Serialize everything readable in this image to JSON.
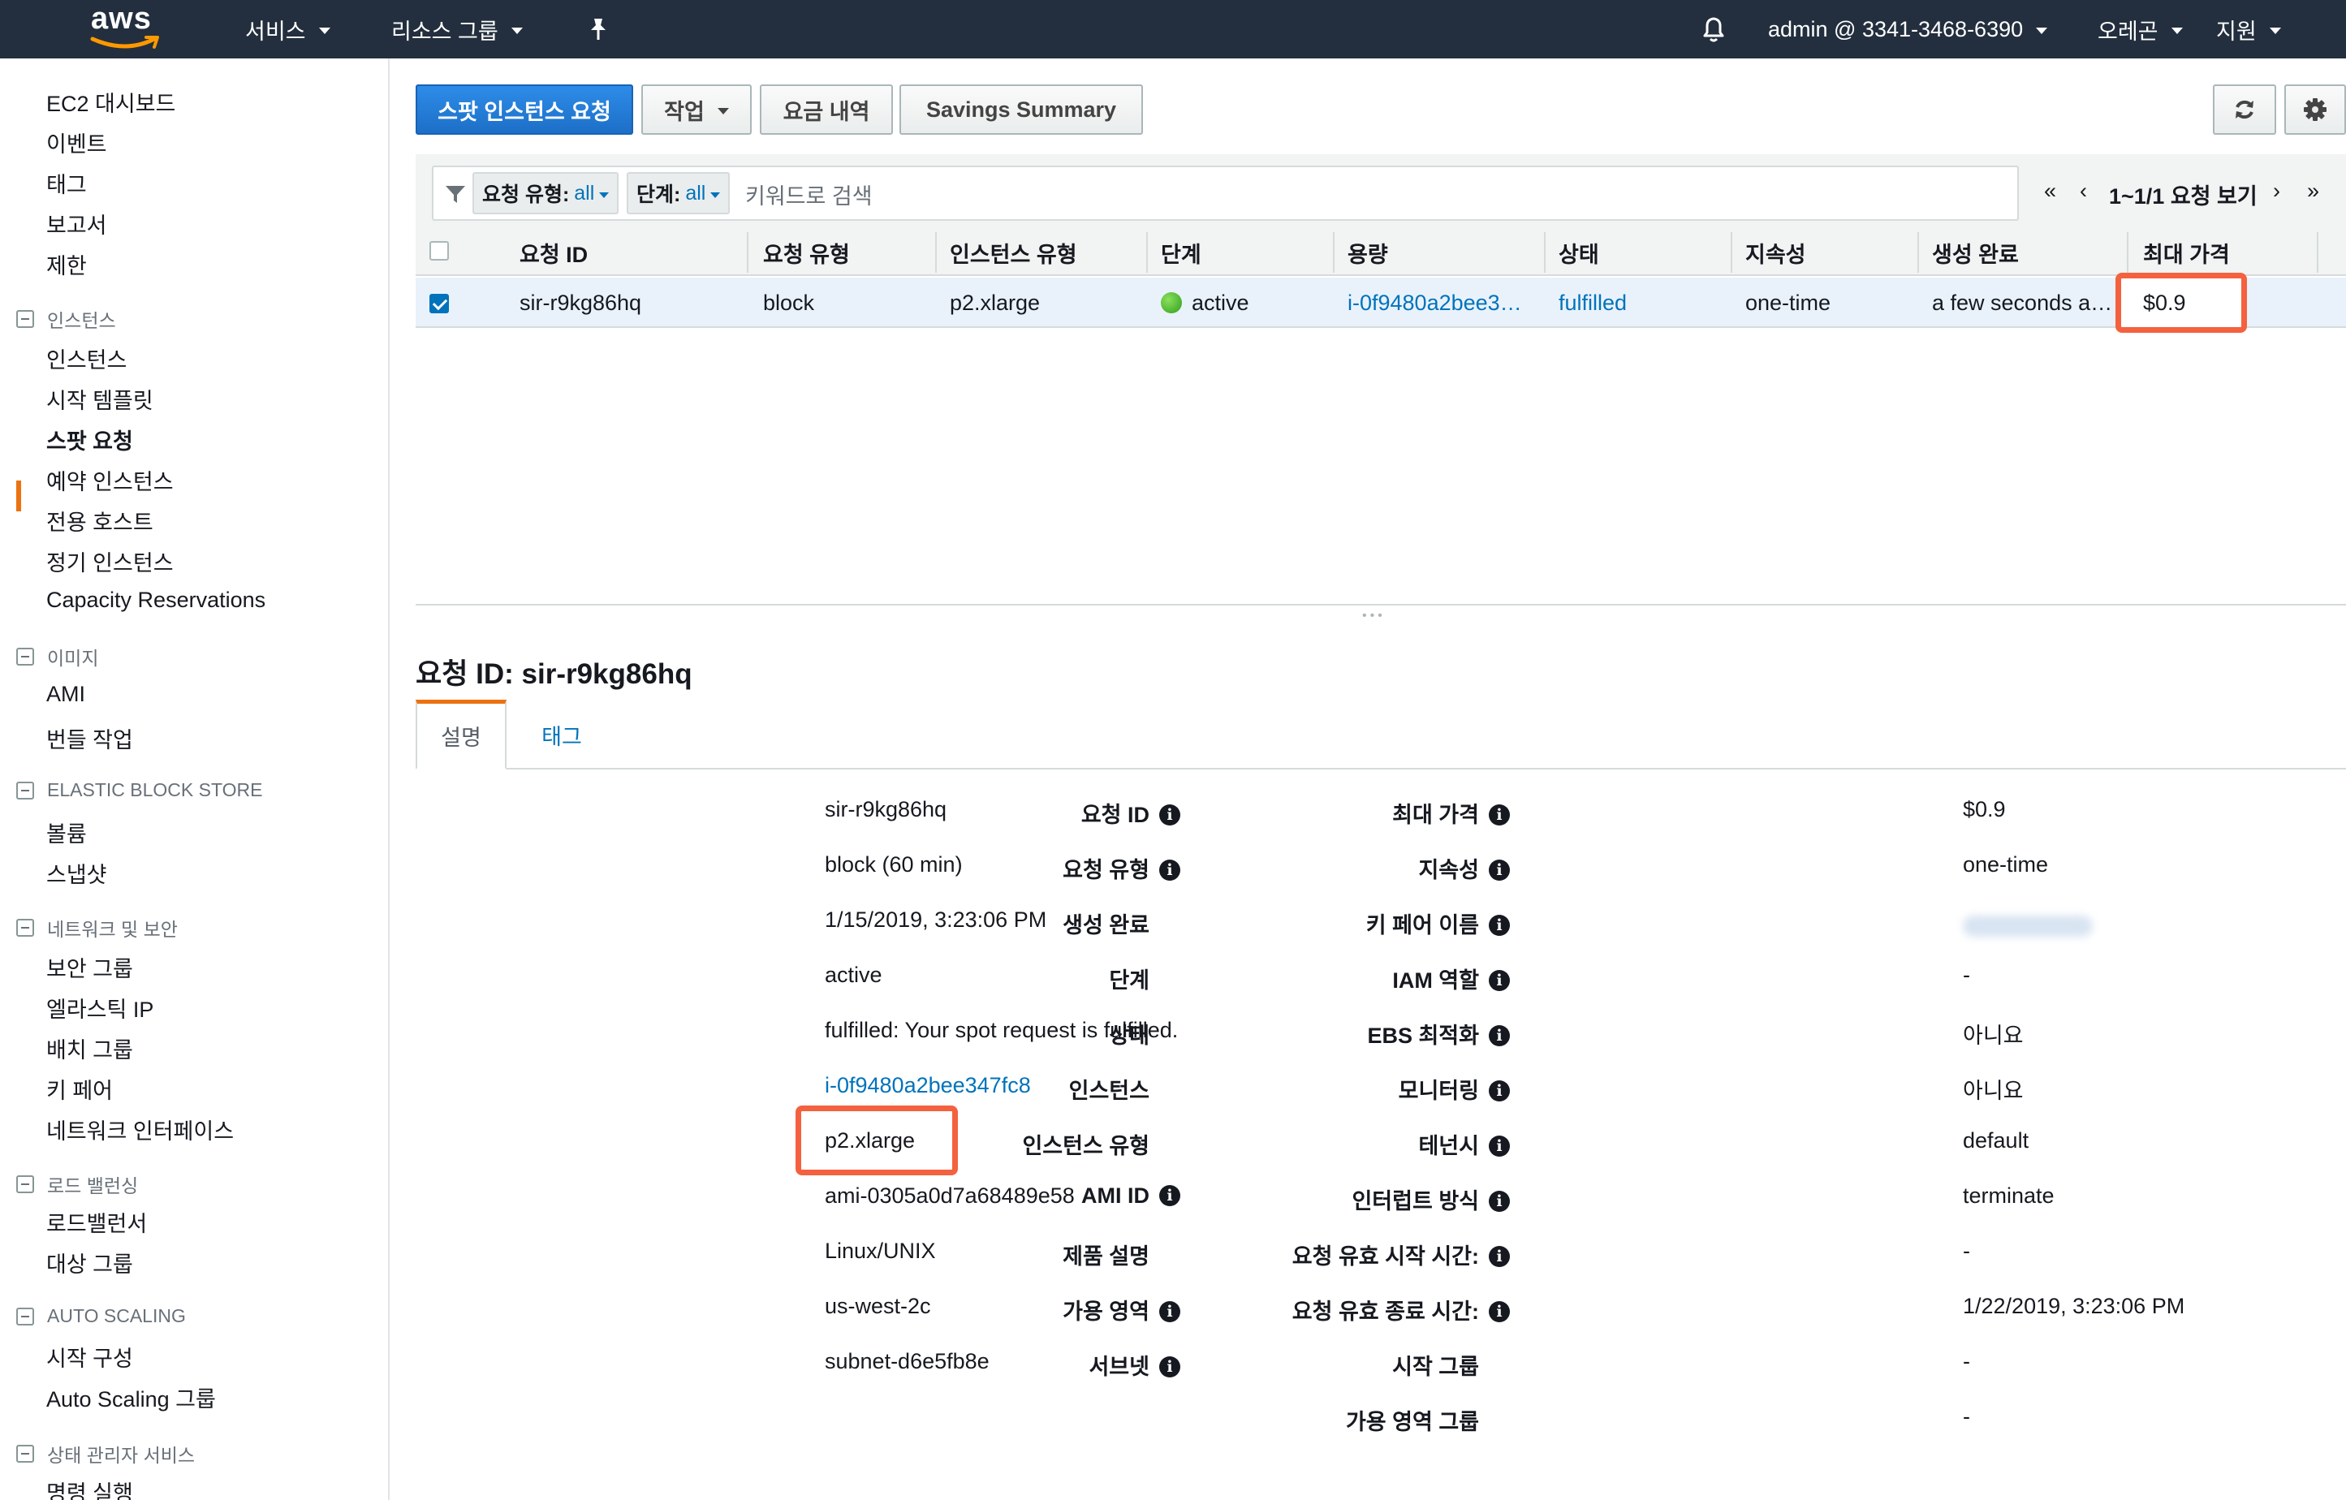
{
  "topbar": {
    "logo": "aws",
    "services": "서비스",
    "resource_groups": "리소스 그룹",
    "pin_icon": "pin-icon",
    "bell_icon": "bell-icon",
    "account": "admin @ 3341-3468-6390",
    "region": "오레곤",
    "support": "지원",
    "background_color": "#232f3e",
    "accent_color": "#ff9900"
  },
  "sidebar": {
    "top_items": [
      "EC2 대시보드",
      "이벤트",
      "태그",
      "보고서",
      "제한"
    ],
    "sections": [
      {
        "title": "인스턴스",
        "items": [
          "인스턴스",
          "시작 템플릿",
          "스팟 요청",
          "예약 인스턴스",
          "전용 호스트",
          "정기 인스턴스",
          "Capacity Reservations"
        ]
      },
      {
        "title": "이미지",
        "items": [
          "AMI",
          "번들 작업"
        ]
      },
      {
        "title": "ELASTIC BLOCK STORE",
        "items": [
          "볼륨",
          "스냅샷"
        ]
      },
      {
        "title": "네트워크 및 보안",
        "items": [
          "보안 그룹",
          "엘라스틱 IP",
          "배치 그룹",
          "키 페어",
          "네트워크 인터페이스"
        ]
      },
      {
        "title": "로드 밸런싱",
        "items": [
          "로드밸런서",
          "대상 그룹"
        ]
      },
      {
        "title": "AUTO SCALING",
        "items": [
          "시작 구성",
          "Auto Scaling 그룹"
        ]
      },
      {
        "title": "상태 관리자 서비스",
        "items": [
          "명령 실행"
        ]
      }
    ],
    "active_item": "스팟 요청",
    "active_color": "#ec7211"
  },
  "toolbar": {
    "request_spot": "스팟 인스턴스 요청",
    "actions": "작업",
    "pricing_history": "요금 내역",
    "savings_summary": "Savings Summary",
    "refresh_icon": "refresh-icon",
    "settings_icon": "gear-icon",
    "primary_color": "#1d6fc7"
  },
  "filter": {
    "filter_icon": "filter-icon",
    "chip1_label": "요청 유형:",
    "chip1_value": "all",
    "chip2_label": "단계:",
    "chip2_value": "all",
    "search_placeholder": "키워드로 검색",
    "pagination": "1~1/1 요청 보기",
    "first_icon": "double-chevron-left-icon",
    "prev_icon": "chevron-left-icon",
    "next_icon": "chevron-right-icon",
    "last_icon": "double-chevron-right-icon"
  },
  "table": {
    "headers": [
      "요청 ID",
      "요청 유형",
      "인스턴스 유형",
      "단계",
      "용량",
      "상태",
      "지속성",
      "생성 완료",
      "최대 가격"
    ],
    "rows": [
      {
        "checked": true,
        "cells": [
          "sir-r9kg86hq",
          "block",
          "p2.xlarge",
          "active",
          "i-0f9480a2bee3…",
          "fulfilled",
          "one-time",
          "a few seconds a…",
          "$0.9"
        ]
      }
    ],
    "status_icon": "green-dot-icon",
    "selected_row_color": "#e9f2fb",
    "highlight_color": "#f4613f"
  },
  "detail": {
    "title": "요청 ID: sir-r9kg86hq",
    "tabs": [
      "설명",
      "태그"
    ],
    "info_icon": "info-icon",
    "left": [
      {
        "label": "요청 ID",
        "info": true,
        "value": "sir-r9kg86hq"
      },
      {
        "label": "요청 유형",
        "info": true,
        "value": "block (60 min)"
      },
      {
        "label": "생성 완료",
        "info": false,
        "value": "1/15/2019, 3:23:06 PM"
      },
      {
        "label": "단계",
        "info": false,
        "value": "active"
      },
      {
        "label": "상태",
        "info": false,
        "value": "fulfilled: Your spot request is fulfilled."
      },
      {
        "label": "인스턴스",
        "info": false,
        "value": "i-0f9480a2bee347fc8",
        "link": true
      },
      {
        "label": "인스턴스 유형",
        "info": false,
        "value": "p2.xlarge",
        "highlight": true
      },
      {
        "label": "AMI ID",
        "info": true,
        "value": "ami-0305a0d7a68489e58"
      },
      {
        "label": "제품 설명",
        "info": false,
        "value": "Linux/UNIX"
      },
      {
        "label": "가용 영역",
        "info": true,
        "value": "us-west-2c"
      },
      {
        "label": "서브넷",
        "info": true,
        "value": "subnet-d6e5fb8e"
      }
    ],
    "right": [
      {
        "label": "최대 가격",
        "info": true,
        "value": "$0.9"
      },
      {
        "label": "지속성",
        "info": true,
        "value": "one-time"
      },
      {
        "label": "키 페어 이름",
        "info": true,
        "value": "",
        "blurred": true
      },
      {
        "label": "IAM 역할",
        "info": true,
        "value": "-"
      },
      {
        "label": "EBS 최적화",
        "info": true,
        "value": "아니요"
      },
      {
        "label": "모니터링",
        "info": true,
        "value": "아니요"
      },
      {
        "label": "테넌시",
        "info": true,
        "value": "default"
      },
      {
        "label": "인터럽트 방식",
        "info": true,
        "value": "terminate"
      },
      {
        "label": "요청 유효 시작 시간:",
        "info": true,
        "value": "-"
      },
      {
        "label": "요청 유효 종료 시간:",
        "info": true,
        "value": "1/22/2019, 3:23:06 PM"
      },
      {
        "label": "시작 그룹",
        "info": false,
        "value": "-"
      },
      {
        "label": "가용 영역 그룹",
        "info": false,
        "value": "-"
      }
    ]
  }
}
